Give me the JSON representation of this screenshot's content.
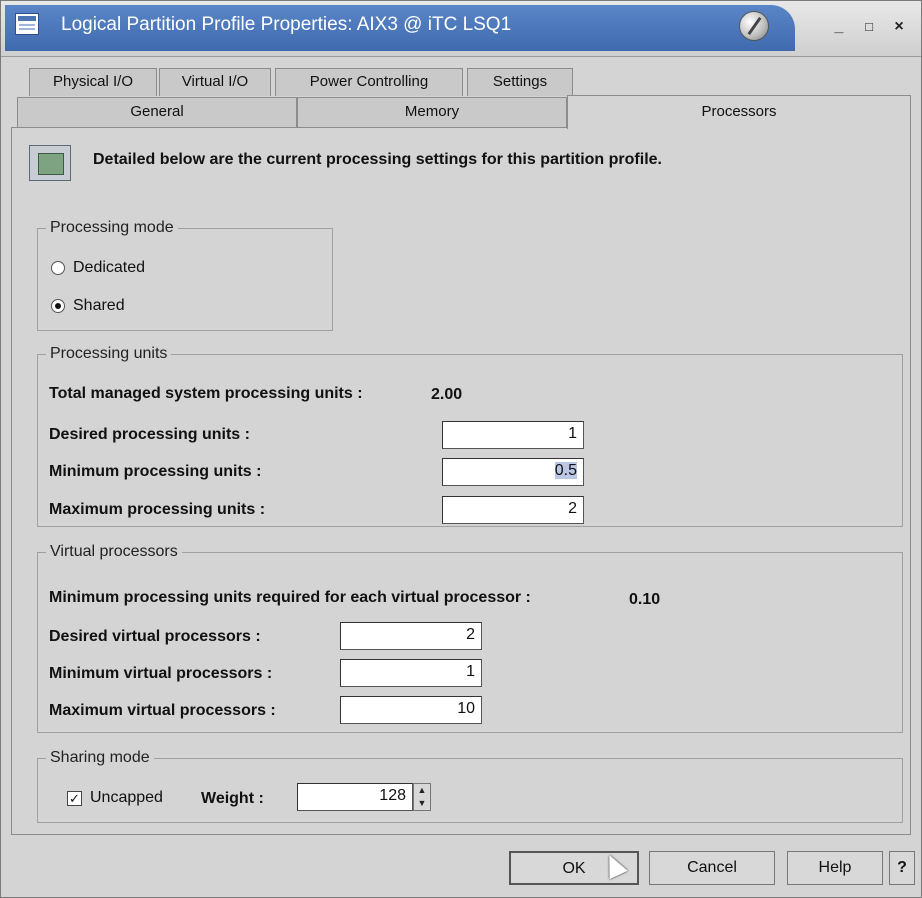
{
  "window": {
    "title": "Logical Partition Profile Properties: AIX3 @ iTC LSQ1",
    "minimize": "_",
    "maximize": "□",
    "close": "×"
  },
  "tabs": {
    "row1": [
      "Physical I/O",
      "Virtual I/O",
      "Power Controlling",
      "Settings"
    ],
    "row2": [
      "General",
      "Memory",
      "Processors"
    ],
    "active": "Processors"
  },
  "info_text": "Detailed below are the current processing settings for this partition profile.",
  "processing_mode": {
    "legend": "Processing mode",
    "options": [
      "Dedicated",
      "Shared"
    ],
    "selected": "Shared"
  },
  "processing_units": {
    "legend": "Processing units",
    "total_label": "Total managed system processing units :",
    "total_value": "2.00",
    "desired_label": "Desired processing units :",
    "desired_value": "1",
    "minimum_label": "Minimum processing units :",
    "minimum_value": "0.5",
    "maximum_label": "Maximum processing units :",
    "maximum_value": "2"
  },
  "virtual_processors": {
    "legend": "Virtual processors",
    "min_required_label": "Minimum processing units required for each virtual processor :",
    "min_required_value": "0.10",
    "desired_label": "Desired virtual processors :",
    "desired_value": "2",
    "minimum_label": "Minimum virtual processors :",
    "minimum_value": "1",
    "maximum_label": "Maximum virtual processors :",
    "maximum_value": "10"
  },
  "sharing_mode": {
    "legend": "Sharing mode",
    "uncapped_label": "Uncapped",
    "uncapped_checked": true,
    "weight_label": "Weight :",
    "weight_value": "128"
  },
  "buttons": {
    "ok": "OK",
    "cancel": "Cancel",
    "help": "Help",
    "question": "?"
  }
}
